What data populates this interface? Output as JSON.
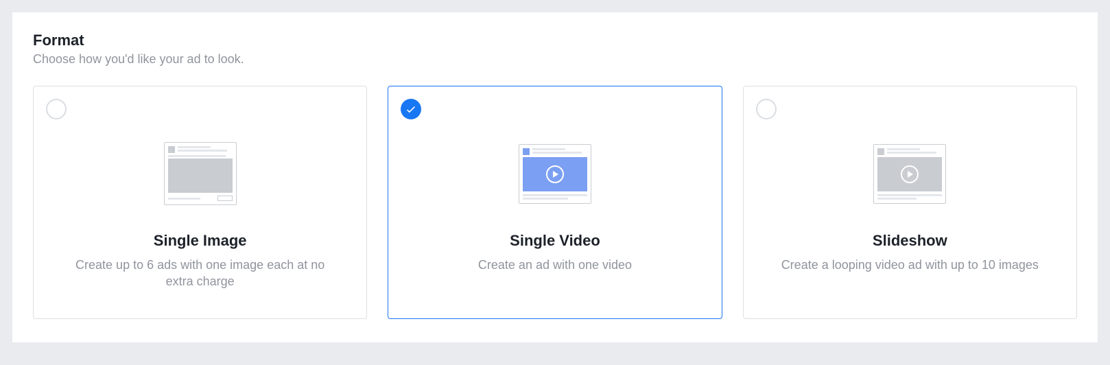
{
  "section": {
    "title": "Format",
    "subtitle": "Choose how you'd like your ad to look."
  },
  "options": {
    "single_image": {
      "title": "Single Image",
      "description": "Create up to 6 ads with one image each at no extra charge",
      "selected": false
    },
    "single_video": {
      "title": "Single Video",
      "description": "Create an ad with one video",
      "selected": true
    },
    "slideshow": {
      "title": "Slideshow",
      "description": "Create a looping video ad with up to 10 images",
      "selected": false
    }
  }
}
